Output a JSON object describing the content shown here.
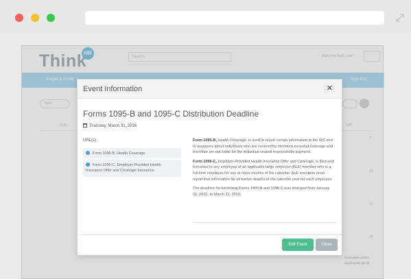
{
  "app": {
    "logo_text": "Think",
    "logo_badge": "HR",
    "search_placeholder": "Search",
    "welcome_text": "Welcome back, user!",
    "nav_left": "Pages & Posts",
    "nav_right": "Sign Out",
    "month_value": "April",
    "days": [
      "SUN",
      "SAT"
    ],
    "cell_numbers": [
      "7",
      "14",
      "21",
      "28"
    ],
    "event_snippet": [
      "Continuation of ACA",
      "reporting due (as of)"
    ]
  },
  "modal": {
    "title": "Event Information",
    "close_symbol": "×",
    "event_title": "Forms 1095-B and 1095-C Distribution Deadline",
    "event_date": "Thursday, March 31, 2016",
    "urls_label": "URL(s)",
    "urls": [
      "Form 1095-B, Health Coverage",
      "Form 1095-C, Employer-Provided Health Insurance Offer and Coverage Insurance"
    ],
    "desc": {
      "p1_bold": "Form 1095-B,",
      "p1_italic": "Health Coverage,",
      "p1_rest": "is used to report certain information to the IRS and to taxpayers about individuals who are covered by minimum essential coverage and therefore are not liable for the individual shared responsibility payment.",
      "p2_bold": "Form 1095-C,",
      "p2_italic": "Employer-Provided Health Insurance Offer and Coverage,",
      "p2_rest": "is filed and furnished to any employee of an applicable large employer (ALE) member who is a full-time employee for one or more months of the calendar. ALE members must report that information for all twelve months of the calendar year for each employee.",
      "p3": "The deadline for furnishing Forms 1095-B and 1095-C was changed from January 31, 2016, to March 31, 2016."
    },
    "edit_label": "Edit Event",
    "close_label": "Close"
  }
}
